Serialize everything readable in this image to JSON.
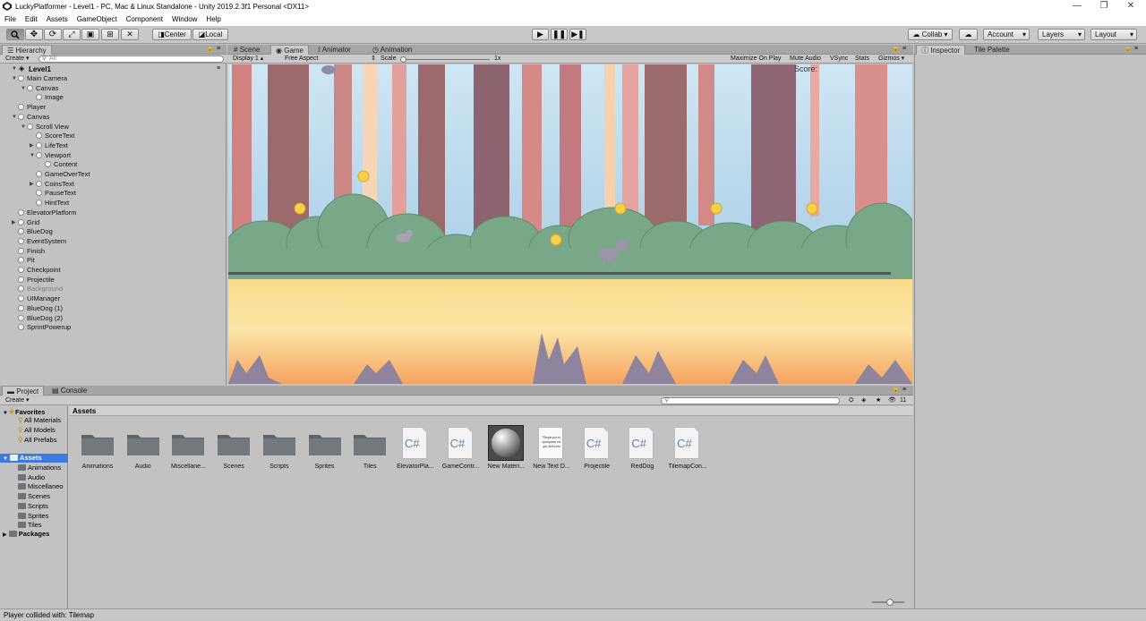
{
  "window": {
    "title": "LuckyPlatformer - Level1 - PC, Mac & Linux Standalone - Unity 2019.2.3f1 Personal <DX11>",
    "minimize": "—",
    "maximize": "❐",
    "close": "✕"
  },
  "menu": [
    "File",
    "Edit",
    "Assets",
    "GameObject",
    "Component",
    "Window",
    "Help"
  ],
  "toolbar": {
    "pivot": "Center",
    "space": "Local",
    "collab": "Collab ▾",
    "account": "Account",
    "layers": "Layers",
    "layout": "Layout"
  },
  "hierarchy": {
    "tab": "Hierarchy",
    "create": "Create ▾",
    "search_placeholder": "All",
    "scene": "Level1",
    "items": [
      {
        "label": "Main Camera",
        "dim": false
      },
      {
        "label": "Canvas",
        "dim": false
      },
      {
        "label": "Image",
        "dim": false
      },
      {
        "label": "Player",
        "dim": false
      },
      {
        "label": "Canvas",
        "dim": false
      },
      {
        "label": "Scroll View",
        "dim": false
      },
      {
        "label": "ScoreText",
        "dim": false
      },
      {
        "label": "LifeText",
        "dim": false
      },
      {
        "label": "Viewport",
        "dim": false
      },
      {
        "label": "Content",
        "dim": false
      },
      {
        "label": "GameOverText",
        "dim": false
      },
      {
        "label": "CoinsText",
        "dim": false
      },
      {
        "label": "PauseText",
        "dim": false
      },
      {
        "label": "HintText",
        "dim": false
      },
      {
        "label": "ElevatorPlatform",
        "dim": false
      },
      {
        "label": "Grid",
        "dim": false
      },
      {
        "label": "BlueDog",
        "dim": false
      },
      {
        "label": "EventSystem",
        "dim": false
      },
      {
        "label": "Finish",
        "dim": false
      },
      {
        "label": "Pit",
        "dim": false
      },
      {
        "label": "Checkpoint",
        "dim": false
      },
      {
        "label": "Projectile",
        "dim": false
      },
      {
        "label": "Background",
        "dim": true
      },
      {
        "label": "UIManager",
        "dim": false
      },
      {
        "label": "BlueDog (1)",
        "dim": false
      },
      {
        "label": "BlueDog (2)",
        "dim": false
      },
      {
        "label": "SprintPowerup",
        "dim": false
      }
    ]
  },
  "center_tabs": [
    "Scene",
    "Game",
    "Animator",
    "Animation"
  ],
  "game_bar": {
    "display": "Display 1",
    "aspect": "Free Aspect",
    "scale_label": "Scale",
    "scale_value": "1x",
    "maximize": "Maximize On Play",
    "mute": "Mute Audio",
    "vsync": "VSync",
    "stats": "Stats",
    "gizmos": "Gizmos ▾"
  },
  "game": {
    "score_label": "Score:"
  },
  "right_tabs": [
    "Inspector",
    "Tile Palette"
  ],
  "project": {
    "tabs": [
      "Project",
      "Console"
    ],
    "create": "Create ▾",
    "hidden_count": "11",
    "favorites": "Favorites",
    "favorite_items": [
      "All Materials",
      "All Models",
      "All Prefabs"
    ],
    "assets_root": "Assets",
    "asset_folders": [
      "Animations",
      "Audio",
      "Miscellaneo",
      "Scenes",
      "Scripts",
      "Sprites",
      "Tiles"
    ],
    "packages": "Packages",
    "breadcrumb": "Assets",
    "items": [
      {
        "label": "Animations",
        "kind": "folder"
      },
      {
        "label": "Audio",
        "kind": "folder"
      },
      {
        "label": "Miscellane...",
        "kind": "folder"
      },
      {
        "label": "Scenes",
        "kind": "folder"
      },
      {
        "label": "Scripts",
        "kind": "folder"
      },
      {
        "label": "Sprites",
        "kind": "folder"
      },
      {
        "label": "Tiles",
        "kind": "folder"
      },
      {
        "label": "ElevatorPla...",
        "kind": "script"
      },
      {
        "label": "GameContr...",
        "kind": "script"
      },
      {
        "label": "New Materi...",
        "kind": "material"
      },
      {
        "label": "New Text D...",
        "kind": "text"
      },
      {
        "label": "Projectile",
        "kind": "script"
      },
      {
        "label": "RedDog",
        "kind": "script"
      },
      {
        "label": "TilemapCon...",
        "kind": "script"
      }
    ],
    "script_glyph": "C#",
    "text_doc_glyph": "Neque porro quisquam est qui dolorem"
  },
  "status": "Player collided with: Tilemap"
}
